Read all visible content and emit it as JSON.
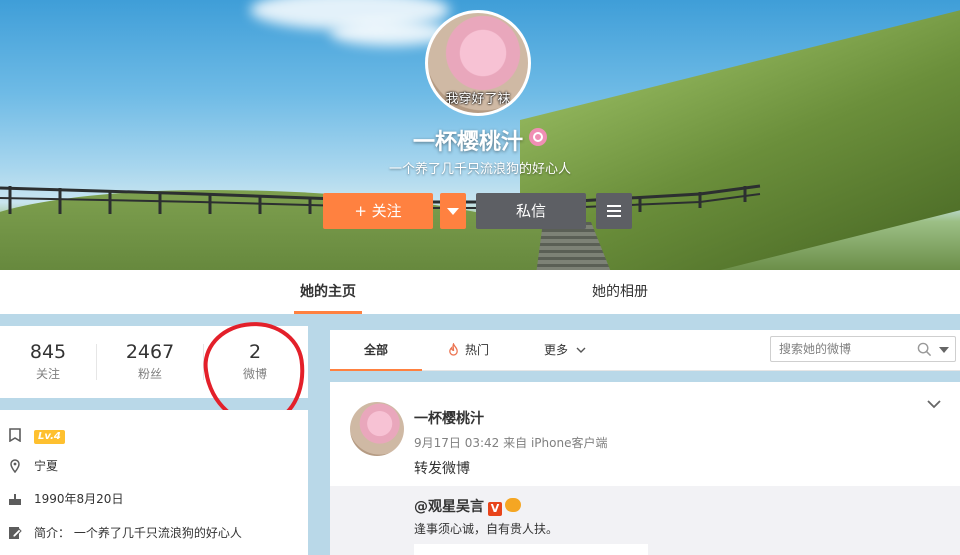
{
  "profile": {
    "name": "一杯樱桃汁",
    "bio": "一个养了几千只流浪狗的好心人",
    "avatar_caption": "我穿好了袜",
    "verify_icon": "pink-badge-icon"
  },
  "actions": {
    "follow_label": "+ 关注",
    "message_label": "私信"
  },
  "tabs": {
    "home": "她的主页",
    "album": "她的相册"
  },
  "stats": [
    {
      "value": "845",
      "label": "关注"
    },
    {
      "value": "2467",
      "label": "粉丝"
    },
    {
      "value": "2",
      "label": "微博"
    }
  ],
  "info": {
    "level": "Lv.4",
    "location": "宁夏",
    "birthday": "1990年8月20日",
    "intro": "简介：  一个养了几千只流浪狗的好心人"
  },
  "filter": {
    "all": "全部",
    "hot": "热门",
    "more": "更多",
    "search_placeholder": "搜索她的微博"
  },
  "post": {
    "author": "一杯樱桃汁",
    "time": "9月17日 03:42",
    "source": "来自 iPhone客户端",
    "text": "转发微博",
    "repost": {
      "author": "@观星吴言",
      "text": "逢事须心诚，自有贵人扶。"
    }
  },
  "colors": {
    "accent": "#ff8140",
    "dark_button": "#5d5f64",
    "annotation_red": "#e3202a",
    "level_badge": "#fec02f"
  }
}
